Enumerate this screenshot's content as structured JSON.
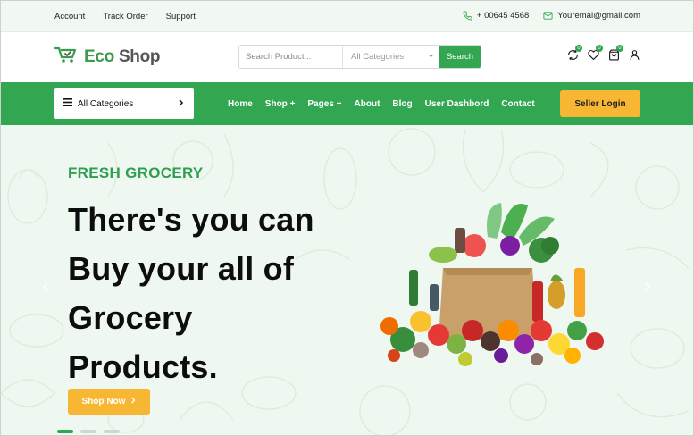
{
  "topbar": {
    "links": [
      "Account",
      "Track Order",
      "Support"
    ],
    "phone": "+ 00645 4568",
    "email": "Youremai@gmail.com",
    "icons": [
      "phone-icon",
      "mail-icon"
    ]
  },
  "header": {
    "logo": {
      "eco": "Eco",
      "shop": "Shop",
      "icon": "cart-icon"
    },
    "search": {
      "placeholder": "Search Product...",
      "category": "All Categories",
      "button": "Search"
    },
    "icons": [
      {
        "name": "compare-icon",
        "badge": "0"
      },
      {
        "name": "wishlist-icon",
        "badge": "0"
      },
      {
        "name": "cart-icon",
        "badge": "0"
      },
      {
        "name": "user-icon"
      }
    ]
  },
  "nav": {
    "all_categories": "All Categories",
    "items": [
      "Home",
      "Shop +",
      "Pages +",
      "About",
      "Blog",
      "User Dashbord",
      "Contact"
    ],
    "seller_login": "Seller Login"
  },
  "hero": {
    "eyebrow": "FRESH GROCERY",
    "headline_lines": [
      "There's you can",
      "Buy your all of",
      "Grocery",
      "Products."
    ],
    "cta": "Shop Now",
    "slides": 3,
    "active_slide": 1
  },
  "colors": {
    "brand_green": "#33a652",
    "accent_yellow": "#f7b733",
    "hero_bg": "#eef7f0",
    "topbar_bg": "#f1f8f2"
  }
}
